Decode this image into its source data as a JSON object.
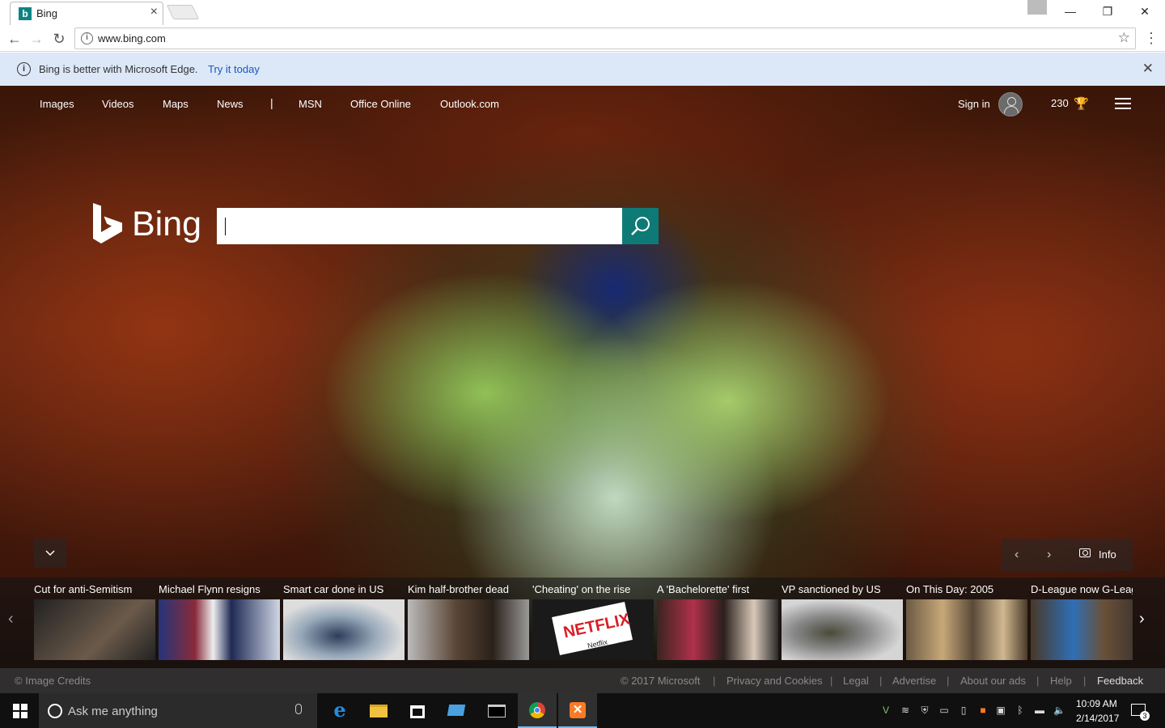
{
  "browser": {
    "tab_title": "Bing",
    "tab_close": "×",
    "url": "www.bing.com",
    "window_controls": {
      "minimize": "—",
      "maximize": "❐",
      "close": "✕"
    }
  },
  "infobar": {
    "message": "Bing is better with Microsoft Edge.",
    "link": "Try it today"
  },
  "topnav": {
    "links": [
      "Images",
      "Videos",
      "Maps",
      "News",
      "MSN",
      "Office Online",
      "Outlook.com"
    ],
    "separator": "|",
    "sign_in": "Sign in",
    "rewards_count": "230"
  },
  "logo": {
    "word": "Bing"
  },
  "search": {
    "value": "",
    "placeholder": ""
  },
  "image_info": {
    "label": "Info"
  },
  "news": [
    {
      "title": "Cut for anti-Semitism",
      "image": "#3b3b3b"
    },
    {
      "title": "Michael Flynn resigns",
      "image": "#2a3f7a"
    },
    {
      "title": "Smart car done in US",
      "image": "#9a9a9a"
    },
    {
      "title": "Kim half-brother dead",
      "image": "#4a4035"
    },
    {
      "title": "'Cheating' on the rise",
      "image": "#1a1a1a"
    },
    {
      "title": "A 'Bachelorette' first",
      "image": "#3a2a25"
    },
    {
      "title": "VP sanctioned by US",
      "image": "#c8c8c8"
    },
    {
      "title": "On This Day: 2005",
      "image": "#7a6a55"
    },
    {
      "title": "D-League now G-Leag",
      "image": "#5a4a3a"
    }
  ],
  "netflix_text": "NETFLIX",
  "netflix_caption": "Netflix",
  "footer": {
    "credits": "Image Credits",
    "copyright": "© 2017 Microsoft",
    "links": [
      "Privacy and Cookies",
      "Legal",
      "Advertise",
      "About our ads",
      "Help"
    ],
    "feedback": "Feedback"
  },
  "taskbar": {
    "search_text": "Ask me anything",
    "time": "10:09 AM",
    "date": "2/14/2017",
    "notifications": "3"
  },
  "colors": {
    "bing_teal": "#0e7a76",
    "infobar_bg": "#dce8f7",
    "link_blue": "#1a55c4"
  }
}
